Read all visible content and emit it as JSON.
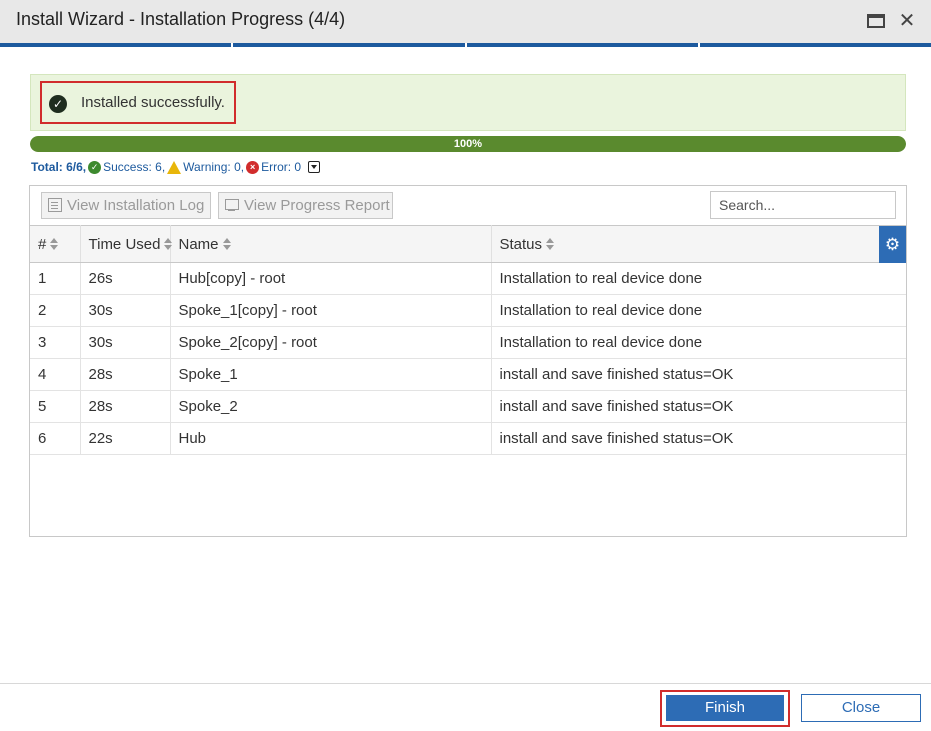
{
  "window": {
    "title": "Install Wizard - Installation Progress (4/4)",
    "maximize_icon": "maximize-icon",
    "close_icon": "close-icon"
  },
  "wizard_steps": {
    "count": 4,
    "current": 4
  },
  "status_banner": {
    "icon": "check-circle-icon",
    "message": "Installed successfully."
  },
  "progress": {
    "value": 100,
    "label": "100%"
  },
  "summary": {
    "total": "Total: 6/6,",
    "success": "Success: 6,",
    "warning": "Warning: 0,",
    "error": "Error: 0"
  },
  "toolbar": {
    "view_log": "View Installation Log",
    "view_report": "View Progress Report",
    "search_placeholder": "Search..."
  },
  "table": {
    "columns": [
      "#",
      "Time Used",
      "Name",
      "Status"
    ],
    "rows": [
      [
        "1",
        "26s",
        "Hub[copy] - root",
        "Installation to real device done"
      ],
      [
        "2",
        "30s",
        "Spoke_1[copy] - root",
        "Installation to real device done"
      ],
      [
        "3",
        "30s",
        "Spoke_2[copy] - root",
        "Installation to real device done"
      ],
      [
        "4",
        "28s",
        "Spoke_1",
        "install and save finished status=OK"
      ],
      [
        "5",
        "28s",
        "Spoke_2",
        "install and save finished status=OK"
      ],
      [
        "6",
        "22s",
        "Hub",
        "install and save finished status=OK"
      ]
    ]
  },
  "footer": {
    "finish": "Finish",
    "close": "Close"
  },
  "colors": {
    "accent": "#2d6cb5",
    "success_bg": "#eaf4dd",
    "progress_fill": "#5a8a2e",
    "highlight": "#d12c2c"
  }
}
